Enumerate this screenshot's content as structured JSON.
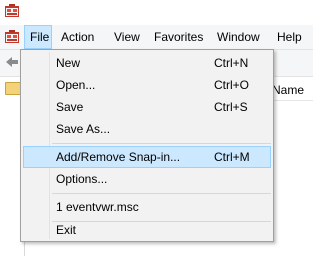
{
  "menubar": {
    "items": [
      "File",
      "Action",
      "View",
      "Favorites",
      "Window",
      "Help"
    ]
  },
  "list": {
    "column_header": "Name"
  },
  "file_menu": {
    "items": [
      {
        "label": "New",
        "shortcut": "Ctrl+N"
      },
      {
        "label": "Open...",
        "shortcut": "Ctrl+O"
      },
      {
        "label": "Save",
        "shortcut": "Ctrl+S"
      },
      {
        "label": "Save As...",
        "shortcut": ""
      },
      {
        "label": "Add/Remove Snap-in...",
        "shortcut": "Ctrl+M",
        "highlighted": true
      },
      {
        "label": "Options...",
        "shortcut": ""
      },
      {
        "label": "1 eventvwr.msc",
        "shortcut": ""
      },
      {
        "label": "Exit",
        "shortcut": ""
      }
    ]
  },
  "colors": {
    "highlight_bg": "#cce8ff",
    "highlight_border": "#99d1ff",
    "menu_bg": "#f2f2f2"
  },
  "icons": [
    "mmc-app-icon",
    "back-arrow-icon",
    "folder-icon"
  ]
}
